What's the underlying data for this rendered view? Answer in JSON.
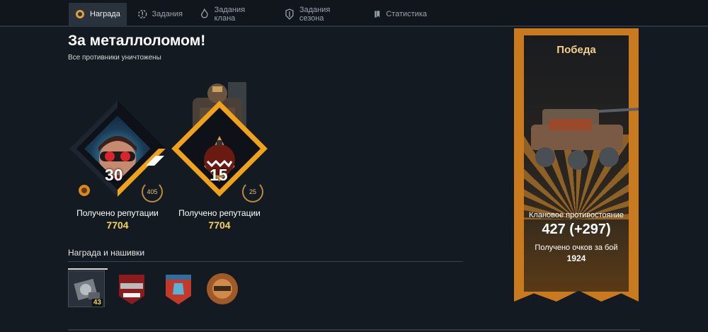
{
  "nav": {
    "tabs": [
      {
        "label": "Награда",
        "icon": "medal-icon",
        "active": true
      },
      {
        "label": "Задания",
        "icon": "tasks-icon",
        "active": false
      },
      {
        "label": "Задания клана",
        "icon": "flame-icon",
        "active": false
      },
      {
        "label": "Задания сезона",
        "icon": "season-icon",
        "active": false
      },
      {
        "label": "Статистика",
        "icon": "stats-icon",
        "active": false
      }
    ]
  },
  "main": {
    "title": "За металлоломом!",
    "subtitle": "Все противники уничтожены"
  },
  "cards": [
    {
      "level": "30",
      "laurel": "405",
      "label": "Получено репутации",
      "value": "7704"
    },
    {
      "level": "15",
      "laurel": "25",
      "label": "Получено репутации",
      "value": "7704"
    }
  ],
  "rewards": {
    "title": "Награда и нашивки",
    "items": [
      {
        "name": "reward-crate-item",
        "count": "43"
      },
      {
        "name": "patch-1"
      },
      {
        "name": "patch-2"
      },
      {
        "name": "patch-3"
      }
    ]
  },
  "banner": {
    "title": "Победа",
    "line1": "Клановое противостояние",
    "line2": "427 (+297)",
    "line3": "Получено очков за бой",
    "line4": "1924"
  },
  "colors": {
    "accent": "#f0a21b",
    "gold": "#f5d35a",
    "banner": "#c97a1e",
    "bg": "#141a22"
  }
}
